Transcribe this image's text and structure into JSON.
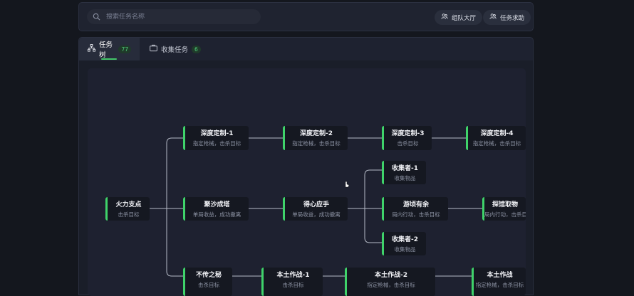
{
  "search": {
    "placeholder": "搜索任务名称"
  },
  "header_buttons": [
    {
      "label": "组队大厅",
      "icon": "team-icon"
    },
    {
      "label": "任务求助",
      "icon": "help-people-icon"
    }
  ],
  "tabs": [
    {
      "label": "任务树",
      "count": "77",
      "icon": "tree-icon",
      "active": true
    },
    {
      "label": "收集任务",
      "count": "6",
      "icon": "briefcase-icon",
      "active": false
    }
  ],
  "tree": {
    "nodes": [
      {
        "id": "n0",
        "title": "火力支点",
        "sub": "击杀目标"
      },
      {
        "id": "n1",
        "title": "深度定制-1",
        "sub": "指定枪械，击杀目标"
      },
      {
        "id": "n2",
        "title": "聚沙成塔",
        "sub": "单局收益，成功撤离"
      },
      {
        "id": "n3",
        "title": "不传之秘",
        "sub": "击杀目标"
      },
      {
        "id": "n4",
        "title": "深度定制-2",
        "sub": "指定枪械，击杀目标"
      },
      {
        "id": "n5",
        "title": "得心应手",
        "sub": "单局收益，成功撤离"
      },
      {
        "id": "n6",
        "title": "本土作战-1",
        "sub": "击杀目标"
      },
      {
        "id": "n7",
        "title": "深度定制-3",
        "sub": "击杀目标"
      },
      {
        "id": "n8",
        "title": "收集者-1",
        "sub": "收集物品"
      },
      {
        "id": "n9",
        "title": "游顷有余",
        "sub": "局内行动，击杀目标"
      },
      {
        "id": "n10",
        "title": "收集者-2",
        "sub": "收集物品"
      },
      {
        "id": "n11",
        "title": "本土作战-2",
        "sub": "指定枪械，击杀目标"
      },
      {
        "id": "n12",
        "title": "深度定制-4",
        "sub": "指定枪械，击杀目标"
      },
      {
        "id": "n13",
        "title": "探馆取物",
        "sub": "局内行动，击杀目标"
      },
      {
        "id": "n14",
        "title": "本土作战",
        "sub": "指定枪械，击杀目标"
      }
    ]
  },
  "colors": {
    "accent": "#3fd36a",
    "badge_text": "#4fd17a"
  }
}
